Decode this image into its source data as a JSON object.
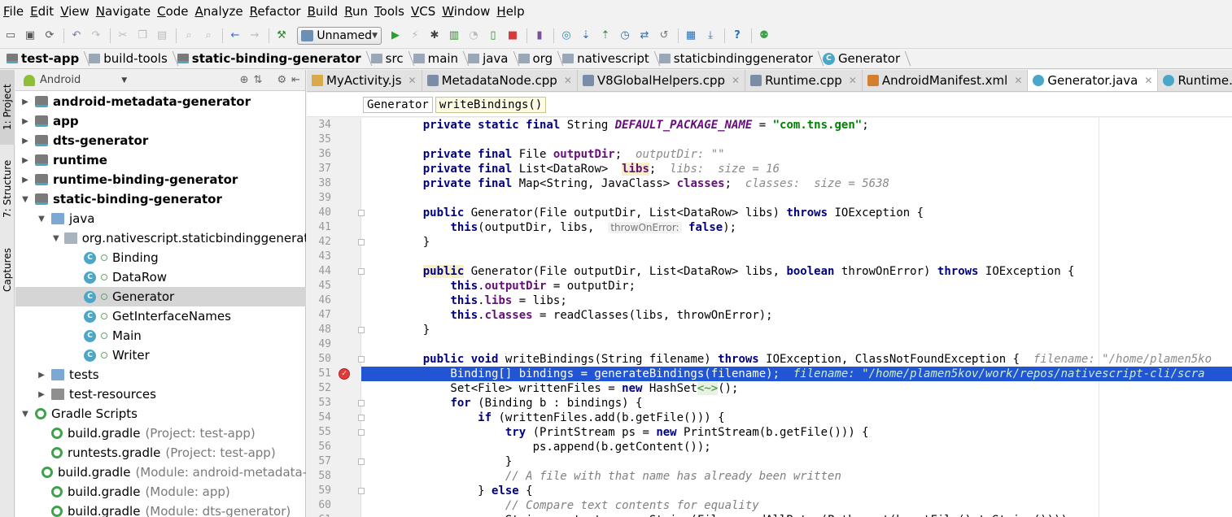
{
  "menu": [
    "File",
    "Edit",
    "View",
    "Navigate",
    "Code",
    "Analyze",
    "Refactor",
    "Build",
    "Run",
    "Tools",
    "VCS",
    "Window",
    "Help"
  ],
  "toolbar": {
    "run_config": "Unnamed",
    "icons": [
      "open-icon",
      "save-icon",
      "sync-icon",
      "undo-icon",
      "redo-icon",
      "cut-icon",
      "copy-icon",
      "paste-icon",
      "find-icon",
      "replace-icon",
      "back-icon",
      "forward-icon",
      "make-icon",
      "run-icon",
      "apply-changes-icon",
      "debug-icon",
      "coverage-icon",
      "profile-icon",
      "attach-debugger-icon",
      "stop-icon",
      "avd-icon",
      "gradle-sync-icon",
      "vcs-update-icon",
      "vcs-commit-icon",
      "vcs-history-icon",
      "vcs-compare-icon",
      "vcs-revert-icon",
      "project-structure-icon",
      "sdk-manager-icon",
      "help-icon",
      "android-monitor-icon"
    ]
  },
  "breadcrumb": [
    {
      "label": "test-app",
      "bold": true,
      "icon": "module"
    },
    {
      "label": "build-tools",
      "bold": false,
      "icon": "folder"
    },
    {
      "label": "static-binding-generator",
      "bold": true,
      "icon": "module"
    },
    {
      "label": "src",
      "bold": false,
      "icon": "folder"
    },
    {
      "label": "main",
      "bold": false,
      "icon": "folder"
    },
    {
      "label": "java",
      "bold": false,
      "icon": "folder"
    },
    {
      "label": "org",
      "bold": false,
      "icon": "folder"
    },
    {
      "label": "nativescript",
      "bold": false,
      "icon": "folder"
    },
    {
      "label": "staticbindinggenerator",
      "bold": false,
      "icon": "folder"
    },
    {
      "label": "Generator",
      "bold": false,
      "icon": "class"
    }
  ],
  "toolstrip": [
    {
      "label": "1: Project",
      "active": true
    },
    {
      "label": "7: Structure",
      "active": false
    },
    {
      "label": "Captures",
      "active": false
    }
  ],
  "project_panel": {
    "view_mode": "Android",
    "tree": [
      {
        "label": "android-metadata-generator",
        "depth": 0,
        "arrow": "▶",
        "icon": "mod",
        "bold": true
      },
      {
        "label": "app",
        "depth": 0,
        "arrow": "▶",
        "icon": "mod",
        "bold": true
      },
      {
        "label": "dts-generator",
        "depth": 0,
        "arrow": "▶",
        "icon": "mod",
        "bold": true
      },
      {
        "label": "runtime",
        "depth": 0,
        "arrow": "▶",
        "icon": "mod",
        "bold": true
      },
      {
        "label": "runtime-binding-generator",
        "depth": 0,
        "arrow": "▶",
        "icon": "mod",
        "bold": true
      },
      {
        "label": "static-binding-generator",
        "depth": 0,
        "arrow": "▼",
        "icon": "mod",
        "bold": true
      },
      {
        "label": "java",
        "depth": 1,
        "arrow": "▼",
        "icon": "fold",
        "bold": false
      },
      {
        "label": "org.nativescript.staticbindinggenerator",
        "depth": 2,
        "arrow": "▼",
        "icon": "pkg",
        "bold": false
      },
      {
        "label": "Binding",
        "depth": 3,
        "arrow": "",
        "icon": "cls",
        "bold": false
      },
      {
        "label": "DataRow",
        "depth": 3,
        "arrow": "",
        "icon": "cls",
        "bold": false
      },
      {
        "label": "Generator",
        "depth": 3,
        "arrow": "",
        "icon": "cls",
        "bold": false,
        "selected": true
      },
      {
        "label": "GetInterfaceNames",
        "depth": 3,
        "arrow": "",
        "icon": "cls",
        "bold": false
      },
      {
        "label": "Main",
        "depth": 3,
        "arrow": "",
        "icon": "cls",
        "bold": false
      },
      {
        "label": "Writer",
        "depth": 3,
        "arrow": "",
        "icon": "cls",
        "bold": false
      },
      {
        "label": "tests",
        "depth": 1,
        "arrow": "▶",
        "icon": "fold",
        "bold": false
      },
      {
        "label": "test-resources",
        "depth": 1,
        "arrow": "▶",
        "icon": "res",
        "bold": false
      },
      {
        "label": "Gradle Scripts",
        "depth": 0,
        "arrow": "▼",
        "icon": "grad",
        "bold": false
      },
      {
        "label": "build.gradle",
        "depth": 1,
        "arrow": "",
        "icon": "grad",
        "bold": false,
        "note": "(Project: test-app)"
      },
      {
        "label": "runtests.gradle",
        "depth": 1,
        "arrow": "",
        "icon": "grad",
        "bold": false,
        "note": "(Project: test-app)"
      },
      {
        "label": "build.gradle",
        "depth": 1,
        "arrow": "",
        "icon": "grad",
        "bold": false,
        "note": "(Module: android-metadata-gene"
      },
      {
        "label": "build.gradle",
        "depth": 1,
        "arrow": "",
        "icon": "grad",
        "bold": false,
        "note": "(Module: app)"
      },
      {
        "label": "build.gradle",
        "depth": 1,
        "arrow": "",
        "icon": "grad",
        "bold": false,
        "note": "(Module: dts-generator)"
      }
    ]
  },
  "tabs": [
    {
      "label": "MyActivity.js",
      "icon": "js",
      "active": false
    },
    {
      "label": "MetadataNode.cpp",
      "icon": "cpp",
      "active": false
    },
    {
      "label": "V8GlobalHelpers.cpp",
      "icon": "cpp",
      "active": false
    },
    {
      "label": "Runtime.cpp",
      "icon": "cpp",
      "active": false
    },
    {
      "label": "AndroidManifest.xml",
      "icon": "xml",
      "active": false
    },
    {
      "label": "Generator.java",
      "icon": "java",
      "active": true
    },
    {
      "label": "Runtime.java",
      "icon": "java",
      "active": false
    }
  ],
  "editor_breadcrumb": [
    "Generator",
    "writeBindings()"
  ],
  "editor": {
    "lines": [
      {
        "n": "34",
        "html": "    <span class='kw'>private static final</span> String <span class='cst'>DEFAULT_PACKAGE_NAME</span> = <span class='str'>\"com.tns.gen\"</span>;"
      },
      {
        "n": "35",
        "html": ""
      },
      {
        "n": "36",
        "html": "    <span class='kw'>private final</span> File <span class='fld'>outputDir</span>;  <span class='hint'>outputDir: \"\"</span>"
      },
      {
        "n": "37",
        "html": "    <span class='kw'>private final</span> List&lt;DataRow&gt;  <span class='fld hl'>libs</span>;  <span class='hint'>libs:  size = 16</span>"
      },
      {
        "n": "38",
        "html": "    <span class='kw'>private final</span> Map&lt;String, JavaClass&gt; <span class='fld'>classes</span>;  <span class='hint'>classes:  size = 5638</span>"
      },
      {
        "n": "39",
        "html": ""
      },
      {
        "n": "40",
        "html": "    <span class='kw'>public</span> Generator(File outputDir, List&lt;DataRow&gt; libs) <span class='kw'>throws</span> IOException {",
        "fold": true
      },
      {
        "n": "41",
        "html": "        <span class='kw'>this</span>(outputDir, libs,  <span class='pname'>throwOnError:</span> <span class='kw'>false</span>);"
      },
      {
        "n": "42",
        "html": "    }",
        "fold": true
      },
      {
        "n": "43",
        "html": ""
      },
      {
        "n": "44",
        "html": "    <span class='kw hl'>public</span> Generator(File outputDir, List&lt;DataRow&gt; libs, <span class='kw'>boolean</span> throwOnError) <span class='kw'>throws</span> IOException {",
        "fold": true
      },
      {
        "n": "45",
        "html": "        <span class='kw'>this</span>.<span class='fld'>outputDir</span> = outputDir;"
      },
      {
        "n": "46",
        "html": "        <span class='kw'>this</span>.<span class='fld'>libs</span> = libs;"
      },
      {
        "n": "47",
        "html": "        <span class='kw'>this</span>.<span class='fld'>classes</span> = readClasses(libs, throwOnError);"
      },
      {
        "n": "48",
        "html": "    }",
        "fold": true
      },
      {
        "n": "49",
        "html": ""
      },
      {
        "n": "50",
        "html": "    <span class='kw'>public void</span> writeBindings(String filename) <span class='kw'>throws</span> IOException, ClassNotFoundException {  <span class='hint'>filename: \"/home/plamen5ko</span>",
        "fold": true
      },
      {
        "n": "51",
        "html": "        Binding[] bindings = generateBindings(filename);  <span class='hint-bp'>filename: \"/home/plamen5kov/work/repos/nativescript-cli/scra</span>",
        "bp": true
      },
      {
        "n": "52",
        "html": "        Set&lt;File&gt; writtenFiles = <span class='kw'>new</span> HashSet<span class='diamond'>&lt;~&gt;</span>();"
      },
      {
        "n": "53",
        "html": "        <span class='kw'>for</span> (Binding b : bindings) {",
        "fold": true
      },
      {
        "n": "54",
        "html": "            <span class='kw'>if</span> (writtenFiles.add(b.getFile())) {",
        "fold": true
      },
      {
        "n": "55",
        "html": "                <span class='kw'>try</span> (PrintStream ps = <span class='kw'>new</span> PrintStream(b.getFile())) {",
        "fold": true
      },
      {
        "n": "56",
        "html": "                    ps.append(b.getContent());"
      },
      {
        "n": "57",
        "html": "                }",
        "fold": true
      },
      {
        "n": "58",
        "html": "                <span class='cmt'>// A file with that name has already been written</span>"
      },
      {
        "n": "59",
        "html": "            } <span class='kw'>else</span> {",
        "fold": true
      },
      {
        "n": "60",
        "html": "                <span class='cmt'>// Compare text contents for equality</span>"
      },
      {
        "n": "61",
        "html": "                String content = new String(Files.readAllBytes(Paths.get(b.getFile().toString())));"
      }
    ]
  }
}
